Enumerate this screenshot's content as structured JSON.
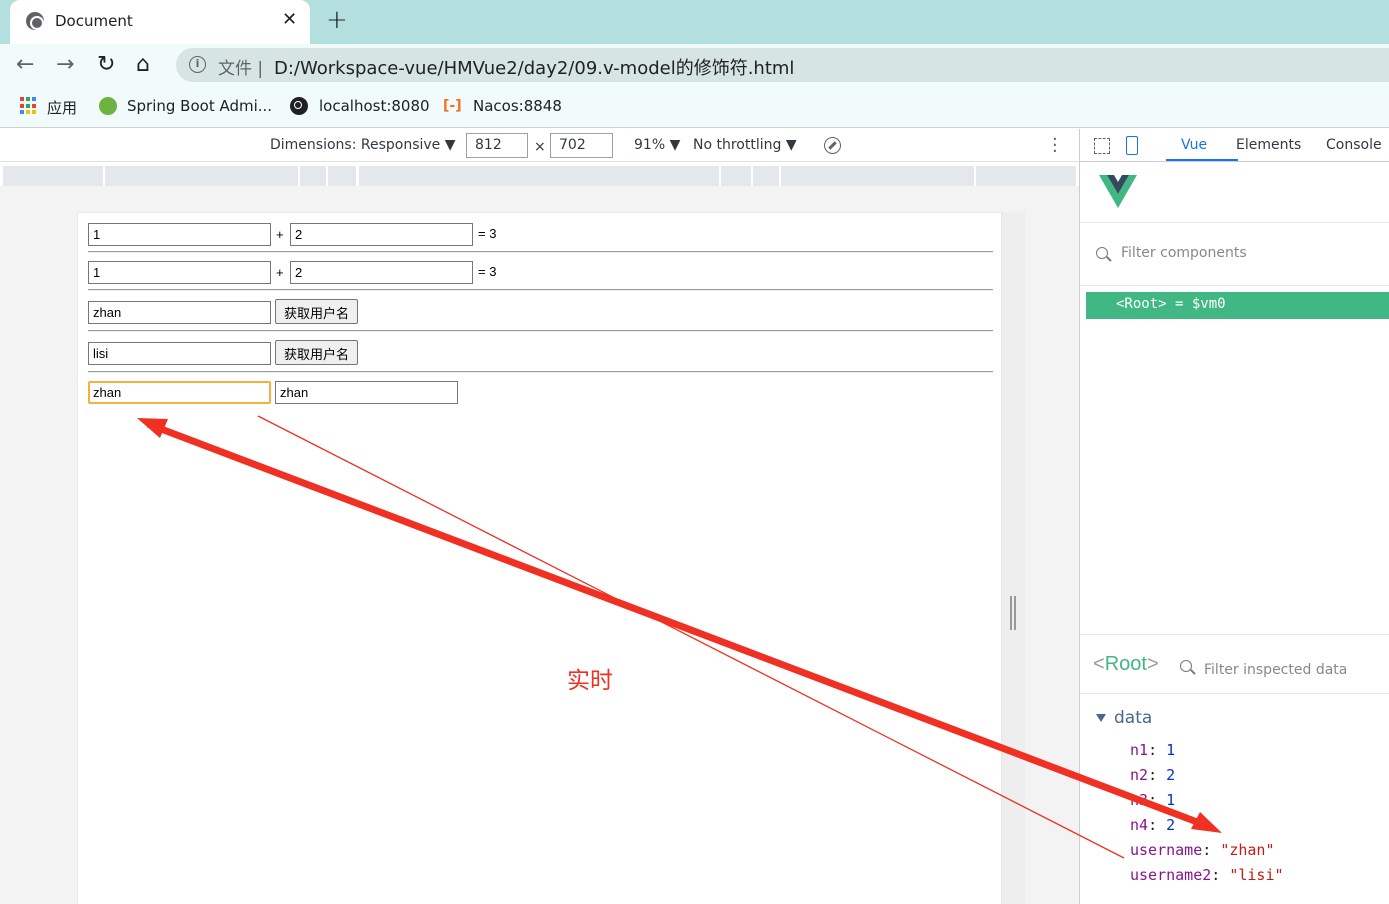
{
  "browser": {
    "tab_title": "Document",
    "tab_close": "✕",
    "new_tab": "+",
    "url_scheme": "文件",
    "url_separator": "|",
    "url": "D:/Workspace-vue/HMVue2/day2/09.v-model的修饰符.html",
    "bookmarks": [
      {
        "label": "应用",
        "icon": "apps-grid-icon"
      },
      {
        "label": "Spring Boot Admi...",
        "icon": "spring-icon"
      },
      {
        "label": "localhost:8080",
        "icon": "globe-icon"
      },
      {
        "label": "Nacos:8848",
        "icon": "nacos-icon"
      }
    ]
  },
  "device_toolbar": {
    "dimensions_label": "Dimensions: Responsive ▼",
    "width": "812",
    "times": "×",
    "height": "702",
    "zoom": "91% ▼",
    "throttling": "No throttling ▼"
  },
  "page": {
    "row1": {
      "a": "1",
      "plus": "+",
      "b": "2",
      "result": "= 3"
    },
    "row2": {
      "a": "1",
      "plus": "+",
      "b": "2",
      "result": "= 3"
    },
    "row3": {
      "input": "zhan",
      "button": "获取用户名"
    },
    "row4": {
      "input": "lisi",
      "button": "获取用户名"
    },
    "row5": {
      "input_a": "zhan",
      "input_b": "zhan"
    }
  },
  "annotation": {
    "text": "实时",
    "color": "#f03022"
  },
  "devtools": {
    "tabs": [
      "Vue",
      "Elements",
      "Console"
    ],
    "active_tab": "Vue",
    "filter_components_placeholder": "Filter components",
    "root_item": "<Root> = $vm0",
    "inspect_title_open": "<",
    "inspect_title_name": "Root",
    "inspect_title_close": ">",
    "filter_inspected_placeholder": "Filter inspected data",
    "data_section": "data",
    "props": [
      {
        "key": "n1",
        "value": "1",
        "type": "number"
      },
      {
        "key": "n2",
        "value": "2",
        "type": "number"
      },
      {
        "key": "n3",
        "value": "1",
        "type": "number"
      },
      {
        "key": "n4",
        "value": "2",
        "type": "number"
      },
      {
        "key": "username",
        "value": "\"zhan\"",
        "type": "string"
      },
      {
        "key": "username2",
        "value": "\"lisi\"",
        "type": "string"
      }
    ]
  },
  "colors": {
    "vue_green": "#41b883",
    "devtools_blue": "#1a73e8",
    "focus_ring": "#f4b13f"
  }
}
